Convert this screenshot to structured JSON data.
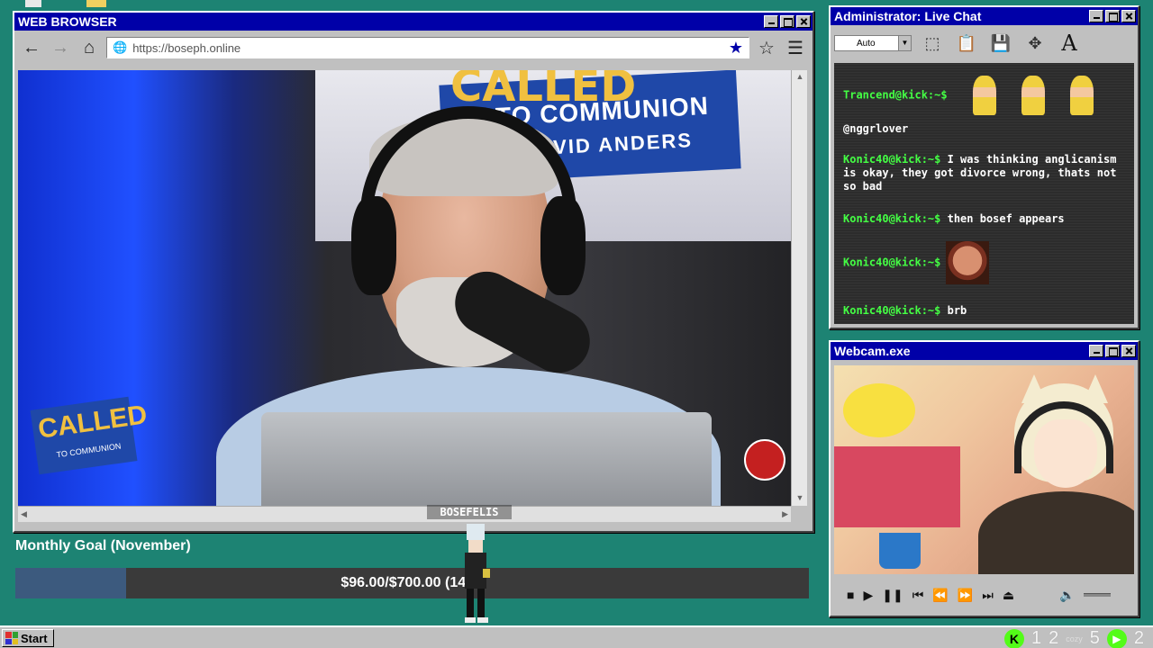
{
  "browser": {
    "title": "WEB BROWSER",
    "url": "https://boseph.online",
    "nav": {
      "back": "back-arrow",
      "forward": "forward-arrow",
      "home": "home-icon"
    },
    "video": {
      "banner_called": "CALLED",
      "banner_line1": "TO COMMUNION",
      "banner_line2": "DAVID ANDERS",
      "logo_called": "CALLED",
      "logo_sub": "TO COMMUNION"
    }
  },
  "goal": {
    "title": "Monthly Goal (November)",
    "text": "$96.00/$700.00 (14%)",
    "progress": 0.14
  },
  "streamer_tag": "BOSEFELIS",
  "chat": {
    "title": "Administrator: Live Chat",
    "zoom_select": "Auto",
    "messages": [
      {
        "user": "Trancend@kick:~$",
        "text": "",
        "emote": "emote-girls"
      },
      {
        "user": "",
        "text": "@nggrlover",
        "emote": ""
      },
      {
        "user": "Konic40@kick:~$",
        "text": " I was thinking anglicanism is okay, they got divorce wrong, thats not so bad",
        "emote": ""
      },
      {
        "user": "Konic40@kick:~$",
        "text": " then bosef appears",
        "emote": ""
      },
      {
        "user": "Konic40@kick:~$",
        "text": "",
        "emote": "emote-laughing-face"
      },
      {
        "user": "Konic40@kick:~$",
        "text": " brb",
        "emote": ""
      }
    ]
  },
  "webcam": {
    "title": "Webcam.exe"
  },
  "taskbar": {
    "start": "Start",
    "tray": [
      "1",
      "2",
      "5",
      "2"
    ],
    "cozy": "cozy"
  },
  "colors": {
    "titlebar": "#0000a8",
    "desktop": "#1d8373",
    "chat_user": "#44ff44",
    "kick_green": "#53fc18"
  }
}
